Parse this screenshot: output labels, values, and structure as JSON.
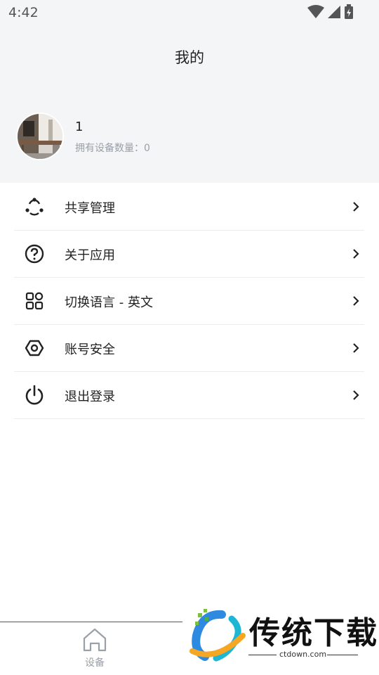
{
  "status_bar": {
    "time": "4:42"
  },
  "header": {
    "title": "我的"
  },
  "profile": {
    "phone": "1",
    "device_count_label": "拥有设备数量：0"
  },
  "menu": {
    "items": [
      {
        "label": "共享管理",
        "icon": "share-icon"
      },
      {
        "label": "关于应用",
        "icon": "question-icon"
      },
      {
        "label": "切换语言 - 英文",
        "icon": "apps-icon"
      },
      {
        "label": "账号安全",
        "icon": "hexagon-security-icon"
      },
      {
        "label": "退出登录",
        "icon": "power-icon"
      }
    ]
  },
  "bottom_nav": {
    "device_label": "设备"
  },
  "watermark": {
    "brand": "传统下载",
    "url": "ctdown.com"
  }
}
